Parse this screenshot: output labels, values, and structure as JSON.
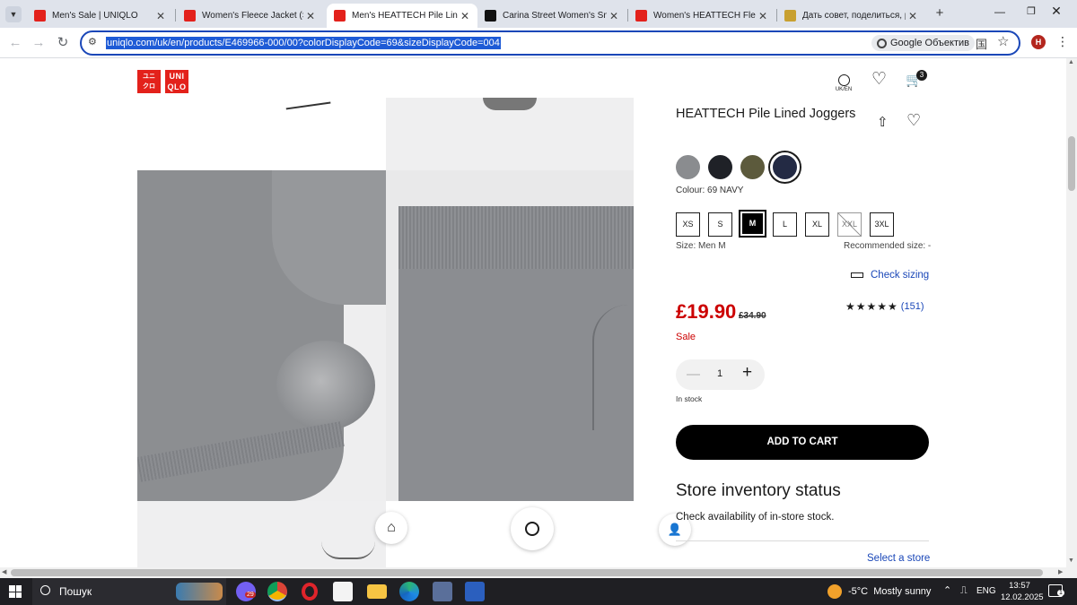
{
  "browser": {
    "tabs": [
      {
        "label": "Men's Sale | UNIQLO"
      },
      {
        "label": "Women's Fleece Jacket (Stan"
      },
      {
        "label": "Men's HEATTECH Pile Lined J"
      },
      {
        "label": "Carina Street Women's Snea"
      },
      {
        "label": "Women's HEATTECH Fleece"
      },
      {
        "label": "Дать совет, поделиться, рас"
      }
    ],
    "url": "uniqlo.com/uk/en/products/E469966-000/00?colorDisplayCode=69&sizeDisplayCode=004",
    "lens_label": "Google Объектив",
    "profile_initial": "H"
  },
  "site": {
    "logo_top": "UNI",
    "logo_bottom": "QLO",
    "logo_jp_top": "ユニ",
    "logo_jp_bottom": "クロ",
    "region": "UK/EN",
    "cart_count": "3"
  },
  "product": {
    "title": "HEATTECH Pile Lined Joggers",
    "colour_label": "Colour: 69 NAVY",
    "colors": [
      {
        "name": "gray",
        "hex": "#8a8c8f"
      },
      {
        "name": "black",
        "hex": "#1f2127"
      },
      {
        "name": "olive",
        "hex": "#5c5a3c"
      },
      {
        "name": "navy",
        "hex": "#232a44"
      }
    ],
    "sizes": [
      {
        "label": "XS",
        "state": "available"
      },
      {
        "label": "S",
        "state": "available"
      },
      {
        "label": "M",
        "state": "selected"
      },
      {
        "label": "L",
        "state": "available"
      },
      {
        "label": "XL",
        "state": "available"
      },
      {
        "label": "XXL",
        "state": "unavailable"
      },
      {
        "label": "3XL",
        "state": "available"
      }
    ],
    "size_label": "Size: Men M",
    "recommended_size": "Recommended size: -",
    "check_sizing": "Check sizing",
    "price": "£19.90",
    "old_price": "£34.90",
    "sale_label": "Sale",
    "rating_stars": "★★★★★",
    "rating_value": 5,
    "rating_count": "(151)",
    "quantity": "1",
    "stock": "In stock",
    "add_to_cart": "ADD TO CART",
    "store_heading": "Store inventory status",
    "store_text": "Check availability of in-store stock.",
    "select_store": "Select a store"
  },
  "taskbar": {
    "search_placeholder": "Пошук",
    "viber_badge": "29",
    "weather": "-5°C  Mostly sunny",
    "language": "ENG",
    "time": "13:57",
    "date": "12.02.2025",
    "notif_count": "1"
  },
  "colors": {
    "brand_red": "#e3211b",
    "price_red": "#cc0000",
    "selection_blue": "#1e5bd6",
    "link_blue": "#1a47b8"
  }
}
